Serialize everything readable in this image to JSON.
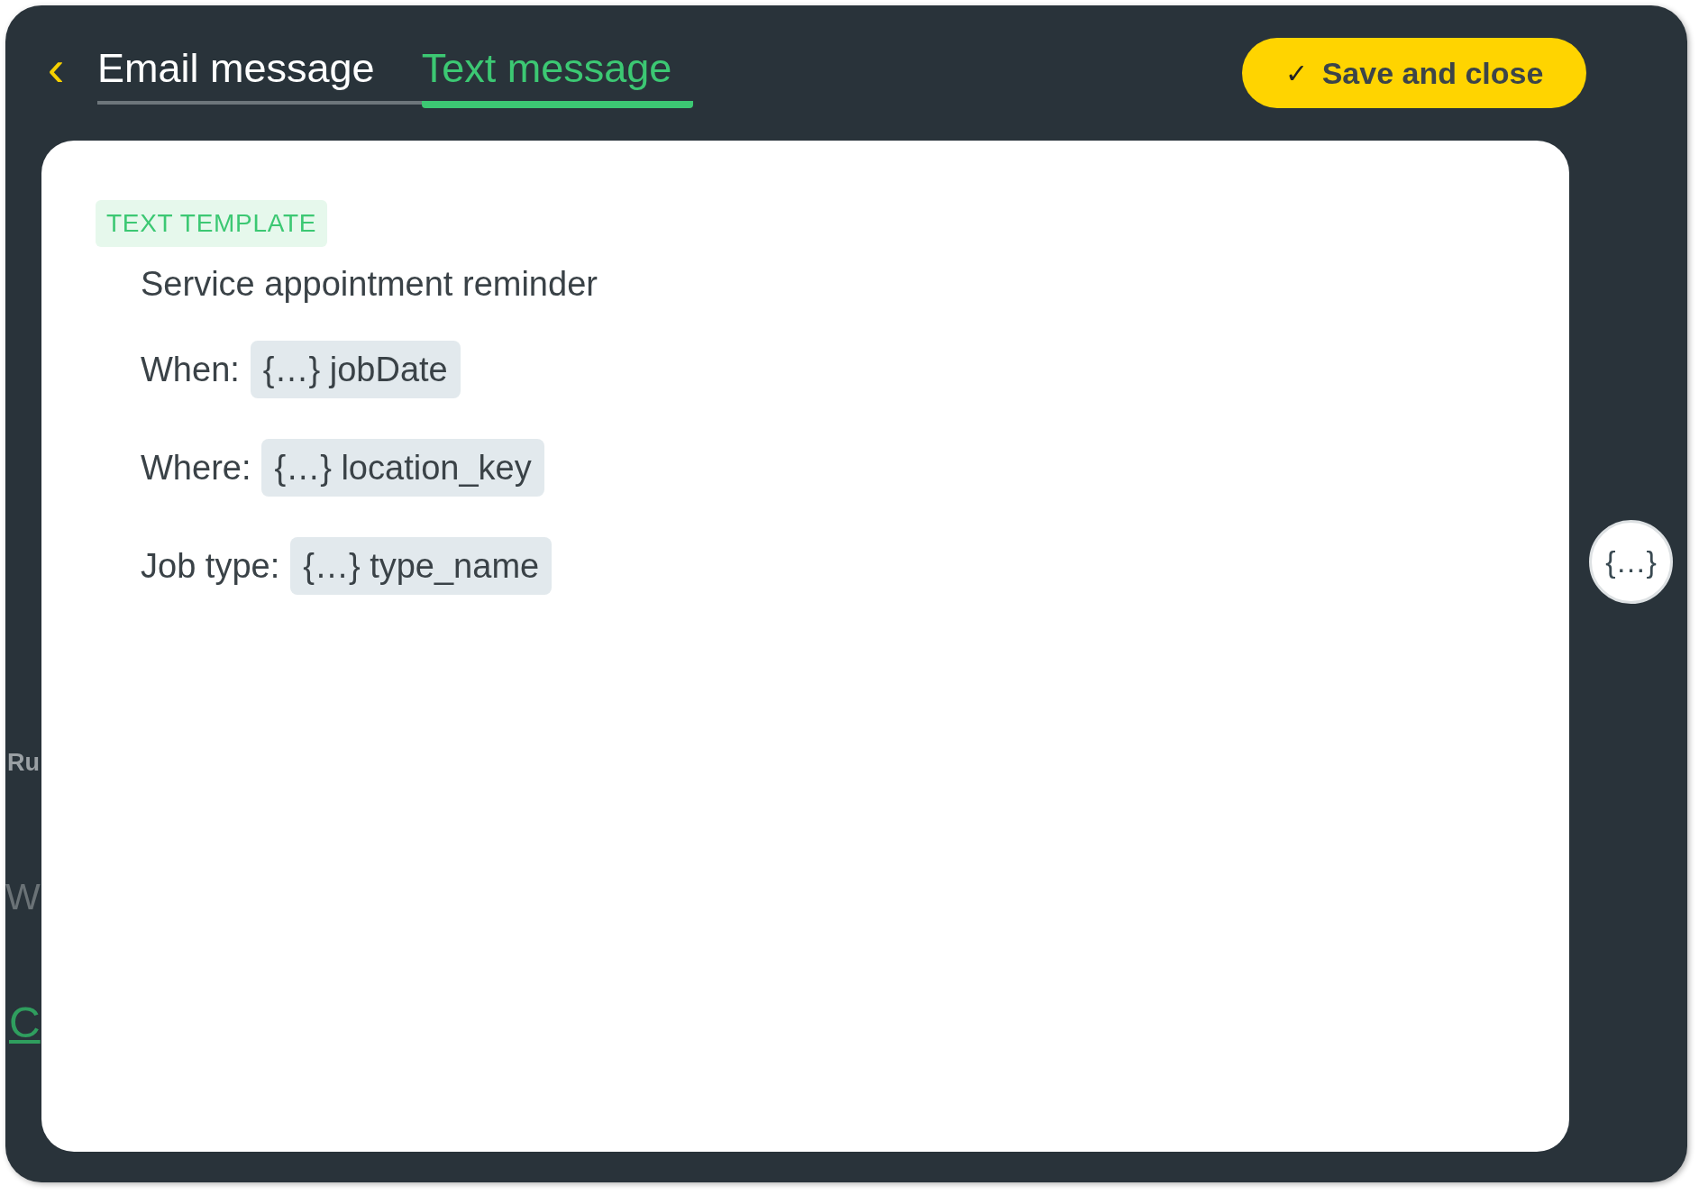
{
  "header": {
    "back": "‹",
    "tabs": [
      {
        "label": "Email message",
        "selected": false
      },
      {
        "label": "Text message",
        "selected": true
      }
    ],
    "save_button": {
      "icon": "✓",
      "label": "Save and close"
    }
  },
  "background_fragments": [
    {
      "text": "Ru",
      "kind": "heading"
    },
    {
      "text": "W",
      "kind": "large"
    },
    {
      "text": "C",
      "kind": "link"
    }
  ],
  "template": {
    "badge": "TEXT TEMPLATE",
    "title": "Service appointment reminder",
    "lines": [
      {
        "label": "When:",
        "chip": "{…} jobDate"
      },
      {
        "label": "Where:",
        "chip": "{…} location_key"
      },
      {
        "label": "Job type:",
        "chip": "{…} type_name"
      }
    ]
  },
  "variables_button": "{…}"
}
